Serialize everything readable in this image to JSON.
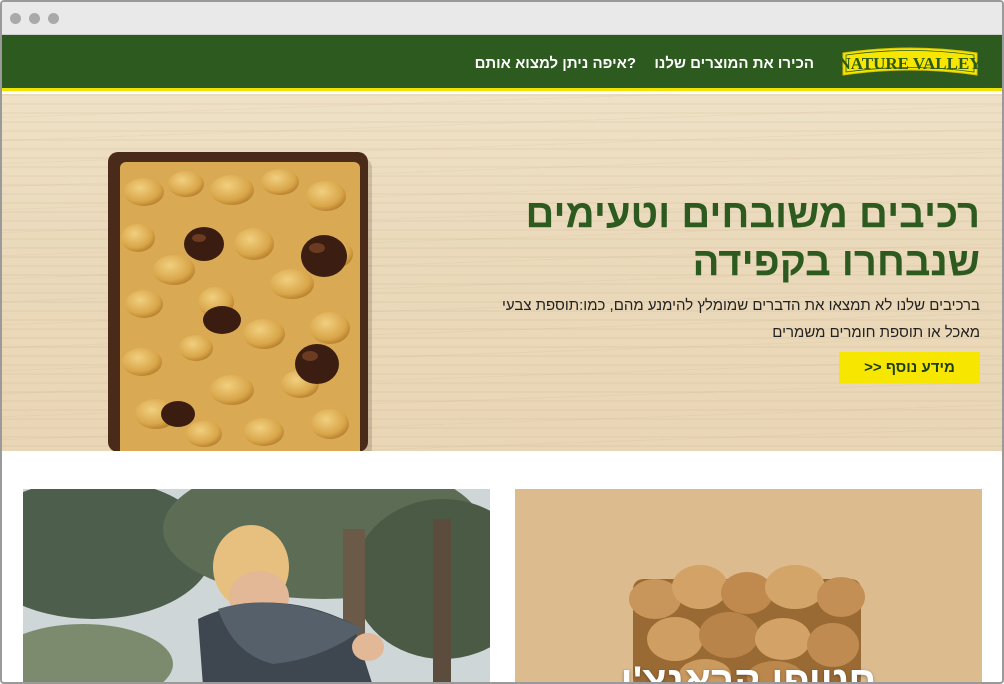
{
  "browser": {
    "window_controls": [
      "close",
      "minimize",
      "maximize"
    ]
  },
  "header": {
    "logo_text": "NATURE VALLEY",
    "nav": [
      {
        "label": "הכירו את המוצרים שלנו"
      },
      {
        "label": "?איפה ניתן למצוא אותם"
      }
    ]
  },
  "hero": {
    "title_line1": "רכיבים משובחים וטעימים",
    "title_line2": "שנבחרו בקפידה",
    "body_line1": "ברכיבים שלנו לא תמצאו את הדברים שמומלץ להימנע מהם, כמו:תוספת צבעי",
    "body_line2": "מאכל או תוספת חומרים משמרים",
    "button_label": "מידע נוסף <<",
    "image": "granola-bar-chocolate-chip"
  },
  "cards": [
    {
      "image": "child-outdoors-with-blanket"
    },
    {
      "image": "granola-crunchy-bar",
      "caption": "חטיפי קראנצ'י"
    }
  ],
  "colors": {
    "brand_green": "#2c5a1f",
    "brand_yellow": "#f7e600",
    "header_underline": "#f2e200",
    "wood": "#ead9bb"
  }
}
